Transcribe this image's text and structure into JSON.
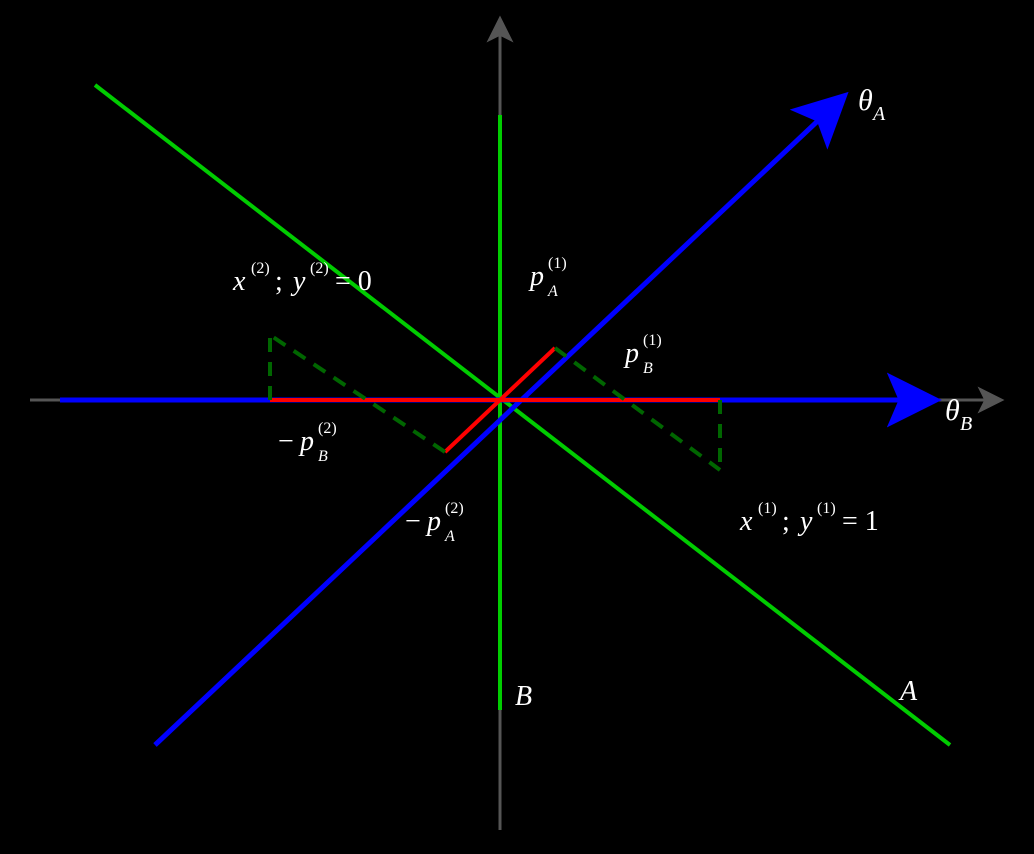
{
  "axes": {
    "theta_A": {
      "label_base": "θ",
      "label_sub": "A"
    },
    "theta_B": {
      "label_base": "θ",
      "label_sub": "B"
    }
  },
  "lines": {
    "A": {
      "label": "A"
    },
    "B": {
      "label": "B"
    }
  },
  "projections": {
    "pA1": {
      "neg": "",
      "base": "p",
      "sup": "(1)",
      "sub": "A"
    },
    "pB1": {
      "neg": "",
      "base": "p",
      "sup": "(1)",
      "sub": "B"
    },
    "pA2": {
      "neg": "−",
      "base": "p",
      "sup": "(2)",
      "sub": "A"
    },
    "pB2": {
      "neg": "−",
      "base": "p",
      "sup": "(2)",
      "sub": "B"
    }
  },
  "points": {
    "x1y1": {
      "x_base": "x",
      "x_sup": "(1)",
      "sep": "; ",
      "y_base": "y",
      "y_sup": "(1)",
      "eq": " = 1"
    },
    "x2y2": {
      "x_base": "x",
      "x_sup": "(2)",
      "sep": "; ",
      "y_base": "y",
      "y_sup": "(2)",
      "eq": " = 0"
    }
  },
  "colors": {
    "bg": "#000000",
    "axis": "#555555",
    "blue": "#0000ff",
    "red": "#ff0000",
    "green": "#00cc00",
    "darkgreen": "#006600",
    "white": "#ffffff"
  },
  "chart_data": {
    "type": "scatter",
    "description": "Two oblique feature axes θ_A (blue) and θ_B (green, here coincident with horizontal) with two data points x^(1) (label y^(1)=1) and x^(2) (label y^(2)=0) and their projections p_A, p_B onto each axis.",
    "origin": {
      "x": 0,
      "y": 0
    },
    "axes": [
      {
        "name": "θ_A",
        "angle_deg": 45,
        "color": "blue"
      },
      {
        "name": "θ_B",
        "angle_deg": 0,
        "color": "blue"
      }
    ],
    "reference_lines": [
      {
        "name": "A",
        "angle_deg": -40,
        "color": "green"
      },
      {
        "name": "B",
        "angle_deg": 90,
        "color": "green"
      }
    ],
    "points": [
      {
        "name": "x^(1)",
        "label": "y^(1)=1",
        "approx_coords": {
          "x": 0.55,
          "y": -0.18
        },
        "projections": {
          "p_A^(1)": 0.12,
          "p_B^(1)": 0.55
        }
      },
      {
        "name": "x^(2)",
        "label": "y^(2)=0",
        "approx_coords": {
          "x": -0.55,
          "y": 0.18
        },
        "projections": {
          "p_A^(2)": -0.22,
          "p_B^(2)": -0.55
        }
      }
    ],
    "xlim": [
      -1,
      1
    ],
    "ylim": [
      -1,
      1
    ]
  }
}
